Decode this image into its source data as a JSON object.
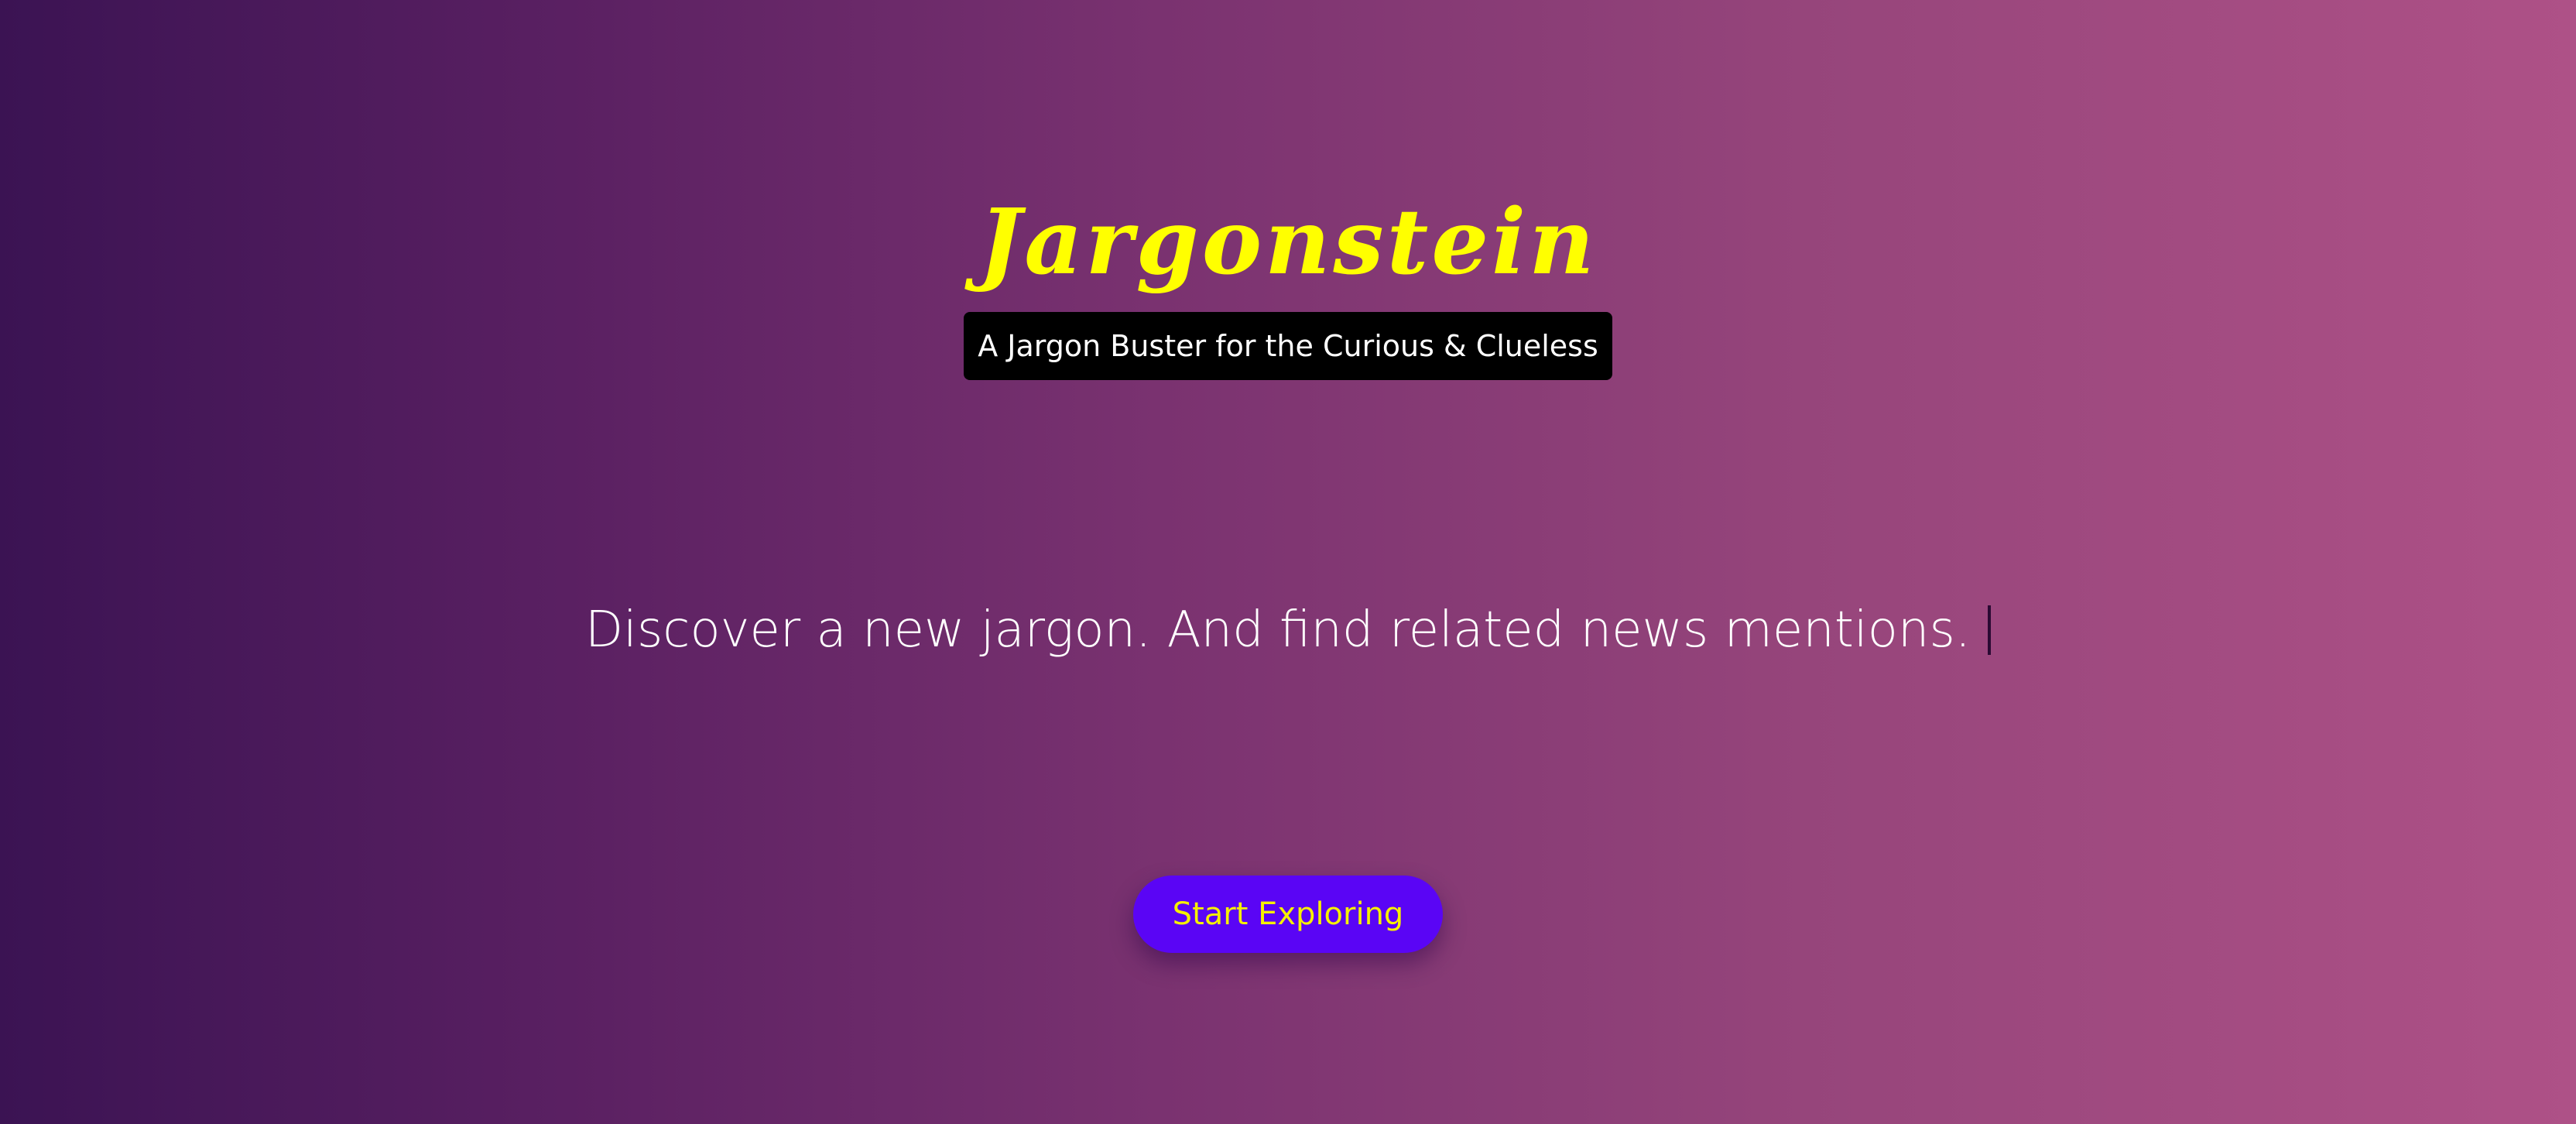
{
  "hero": {
    "title": "Jargonstein",
    "tagline": "A Jargon Buster for the Curious & Clueless",
    "typed_text": "Discover a new jargon. And find related news mentions.",
    "cta_label": "Start Exploring"
  },
  "colors": {
    "gradient_start": "#3b1353",
    "gradient_end": "#ae5187",
    "title": "#ffff00",
    "tagline_background": "#000000",
    "tagline_text": "#ffffff",
    "button_background": "#5a05f5",
    "button_text": "#f5f000"
  }
}
